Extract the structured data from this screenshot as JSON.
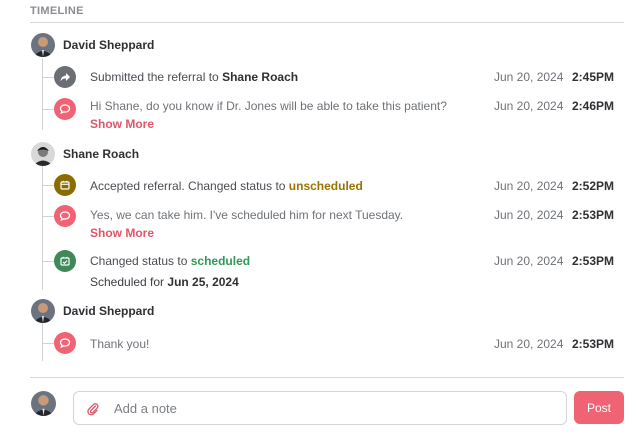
{
  "timeline": {
    "title": "TIMELINE",
    "groups": [
      {
        "author": "David Sheppard",
        "events": [
          {
            "icon": "forward-arrow-icon",
            "color": "#6b6e73",
            "text_pre": "Submitted the referral to ",
            "text_strong": "Shane Roach",
            "date": "Jun 20, 2024",
            "time": "2:45PM"
          },
          {
            "icon": "comment-icon",
            "color": "#f06374",
            "text": "Hi Shane, do you know if Dr. Jones will be able to take this patient?",
            "show_more": "Show More",
            "date": "Jun 20, 2024",
            "time": "2:46PM"
          }
        ]
      },
      {
        "author": "Shane Roach",
        "events": [
          {
            "icon": "calendar-icon",
            "color": "#8b6c00",
            "text_pre": "Accepted referral. Changed status to ",
            "status": "unscheduled",
            "date": "Jun 20, 2024",
            "time": "2:52PM"
          },
          {
            "icon": "comment-icon",
            "color": "#f06374",
            "text": "Yes, we can take him. I've scheduled him for next Tuesday.",
            "show_more": "Show More",
            "date": "Jun 20, 2024",
            "time": "2:53PM"
          },
          {
            "icon": "calendar-check-icon",
            "color": "#3d8a58",
            "text_pre": "Changed status to ",
            "status": "scheduled",
            "sub_pre": "Scheduled for ",
            "sub_strong": "Jun 25, 2024",
            "date": "Jun 20, 2024",
            "time": "2:53PM"
          }
        ]
      },
      {
        "author": "David Sheppard",
        "events": [
          {
            "icon": "comment-icon",
            "color": "#f06374",
            "text": "Thank you!",
            "date": "Jun 20, 2024",
            "time": "2:53PM"
          }
        ]
      }
    ]
  },
  "composer": {
    "placeholder": "Add a note",
    "post_label": "Post",
    "attach_icon": "paperclip-icon"
  }
}
